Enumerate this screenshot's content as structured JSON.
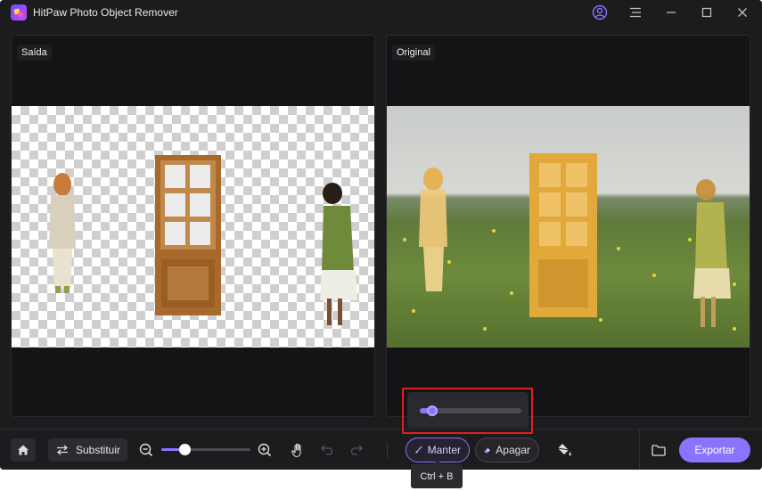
{
  "window": {
    "title": "HitPaw Photo Object Remover",
    "icons": [
      "app-logo",
      "account-icon",
      "menu-icon",
      "minimize-icon",
      "maximize-icon",
      "close-icon"
    ]
  },
  "panels": {
    "output_label": "Saída",
    "original_label": "Original"
  },
  "toolbar": {
    "home_icon": "home-icon",
    "replace_icon": "swap-icon",
    "replace_label": "Substituir",
    "zoom_level_fraction": 0.26,
    "keep_label": "Manter",
    "erase_label": "Apagar",
    "fill_icon": "paint-bucket-icon",
    "folder_icon": "folder-icon",
    "export_label": "Exportar"
  },
  "brush": {
    "size_fraction": 0.12
  },
  "tooltip": {
    "text": "Ctrl + B"
  },
  "colors": {
    "accent": "#8b73ff",
    "background": "#1c1c1f",
    "panel": "#141416",
    "highlight": "#e02020"
  }
}
